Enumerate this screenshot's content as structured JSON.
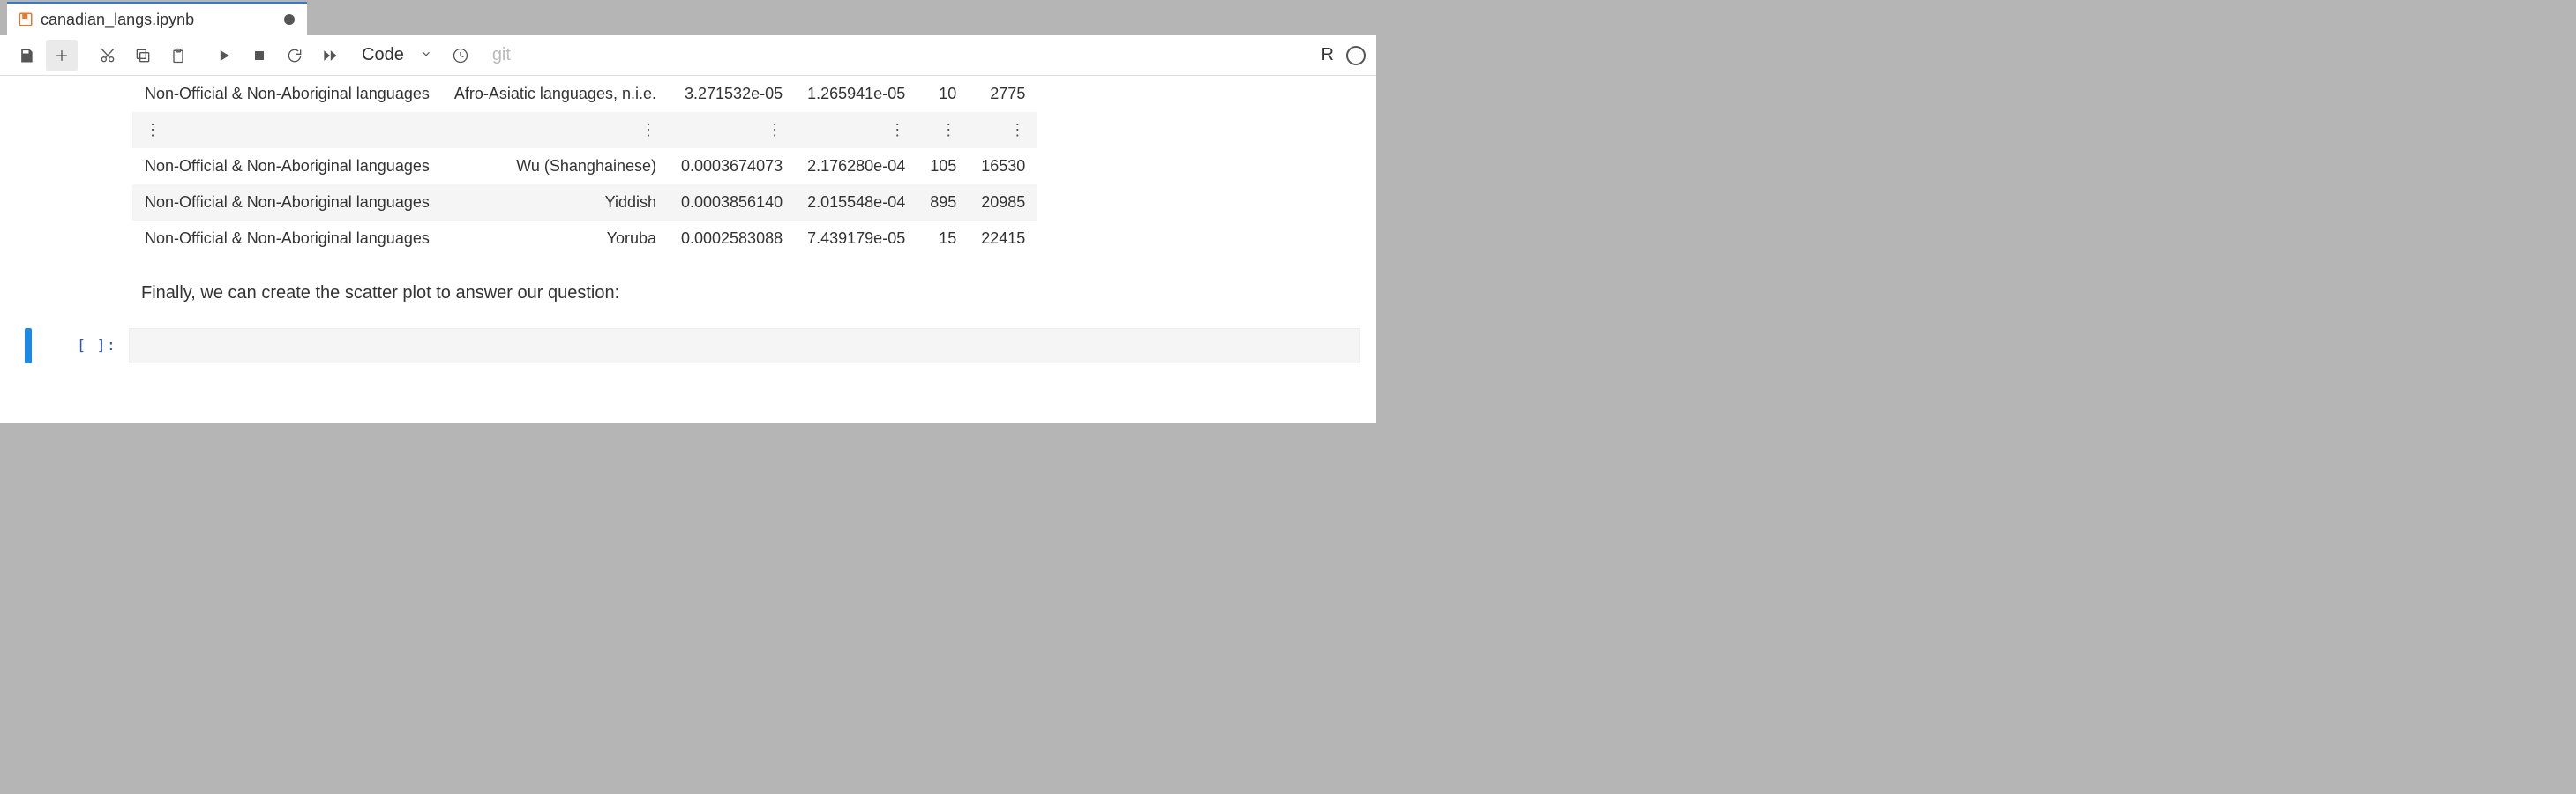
{
  "tab": {
    "title": "canadian_langs.ipynb"
  },
  "toolbar": {
    "cellTypeLabel": "Code",
    "gitLabel": "git",
    "kernelLabel": "R"
  },
  "table": {
    "rows": [
      {
        "c0": "Non-Official & Non-Aboriginal languages",
        "c1": "Afro-Asiatic languages, n.i.e.",
        "c2": "3.271532e-05",
        "c3": "1.265941e-05",
        "c4": "10",
        "c5": "2775",
        "shade": false
      },
      {
        "ellipsis": true,
        "shade": true
      },
      {
        "c0": "Non-Official & Non-Aboriginal languages",
        "c1": "Wu (Shanghainese)",
        "c2": "0.0003674073",
        "c3": "2.176280e-04",
        "c4": "105",
        "c5": "16530",
        "shade": false
      },
      {
        "c0": "Non-Official & Non-Aboriginal languages",
        "c1": "Yiddish",
        "c2": "0.0003856140",
        "c3": "2.015548e-04",
        "c4": "895",
        "c5": "20985",
        "shade": true
      },
      {
        "c0": "Non-Official & Non-Aboriginal languages",
        "c1": "Yoruba",
        "c2": "0.0002583088",
        "c3": "7.439179e-05",
        "c4": "15",
        "c5": "22415",
        "shade": false
      }
    ]
  },
  "markdown": {
    "text": "Finally, we can create the scatter plot to answer our question:"
  },
  "codecell": {
    "prompt": "[  ]:"
  }
}
